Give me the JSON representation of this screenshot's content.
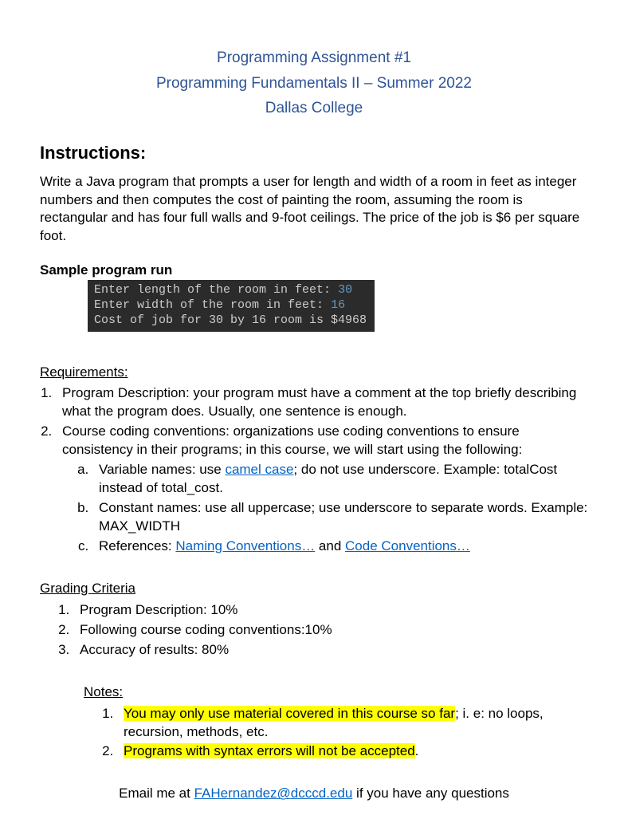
{
  "header": {
    "line1": "Programming Assignment #1",
    "line2": "Programming Fundamentals II – Summer 2022",
    "line3": "Dallas College"
  },
  "instructions": {
    "title": "Instructions:",
    "body": "Write a Java program that prompts a user for length and width of a room in feet as integer numbers and then computes the cost of painting the room, assuming the room is rectangular and has four full walls and 9-foot ceilings. The price of the job is $6 per square foot."
  },
  "sample": {
    "title": "Sample program run",
    "line1_prompt": "Enter length of the room in feet: ",
    "line1_val": "30",
    "line2_prompt": "Enter width of the room in feet: ",
    "line2_val": "16",
    "line3": "Cost of job for 30 by 16 room is $4968"
  },
  "requirements": {
    "title": "Requirements:",
    "item1": "Program Description: your program must have a comment at the top briefly describing what the program does. Usually, one sentence is enough.",
    "item2": "Course coding conventions: organizations use coding conventions to ensure consistency in their programs; in this course, we will start using the following:",
    "sub_a_prefix": "Variable names: use ",
    "sub_a_link": "camel case",
    "sub_a_suffix": "; do not use underscore. Example: totalCost instead of total_cost.",
    "sub_b": "Constant names: use all uppercase; use underscore to separate words. Example:  MAX_WIDTH",
    "sub_c_prefix": "References: ",
    "sub_c_link1": "Naming Conventions…",
    "sub_c_mid": " and ",
    "sub_c_link2": "Code Conventions…"
  },
  "grading": {
    "title": "Grading Criteria",
    "item1": "Program Description: 10%",
    "item2": "Following course coding conventions:10%",
    "item3": "Accuracy of results: 80%"
  },
  "notes": {
    "title": "Notes:",
    "item1_hl": "You may only use material covered in this course so far",
    "item1_rest": "; i. e: no loops, recursion, methods, etc.",
    "item2_hl": "Programs with syntax errors will not be accepted",
    "item2_dot": "."
  },
  "footer": {
    "prefix": "Email me at ",
    "email": "FAHernandez@dcccd.edu",
    "suffix": " if you have any questions"
  }
}
